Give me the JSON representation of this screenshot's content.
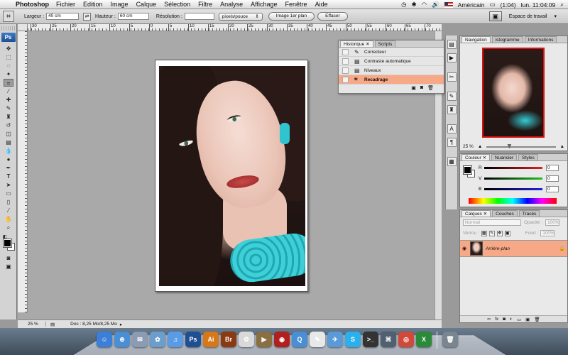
{
  "menubar": {
    "app_name": "Photoshop",
    "menus": [
      "Fichier",
      "Edition",
      "Image",
      "Calque",
      "Sélection",
      "Filtre",
      "Analyse",
      "Affichage",
      "Fenêtre",
      "Aide"
    ],
    "input_source": "Américain",
    "battery": "(1:04)",
    "clock": "lun. 11:04:09"
  },
  "options_bar": {
    "width_label": "Largeur :",
    "width_value": "40 cm",
    "height_label": "Hauteur :",
    "height_value": "60 cm",
    "resolution_label": "Résolution :",
    "resolution_value": "",
    "unit_select": "pixels/pouce",
    "front_image_button": "Image 1er plan",
    "clear_button": "Effacer",
    "workspace_label": "Espace de travail"
  },
  "rulers": {
    "top_ticks": [
      "30",
      "25",
      "20",
      "15",
      "10",
      "5",
      "0",
      "5",
      "10",
      "15",
      "20",
      "25",
      "30",
      "35",
      "40",
      "45",
      "50",
      "55",
      "60",
      "65",
      "70"
    ]
  },
  "status_bar": {
    "zoom": "25 %",
    "doc_size": "Doc : 8,25 Mo/8,25 Mo"
  },
  "history_panel": {
    "tabs": [
      "Historique",
      "Scripts"
    ],
    "items": [
      {
        "label": "Correcteur",
        "icon": "brush-icon",
        "active": false
      },
      {
        "label": "Contraste automatique",
        "icon": "document-icon",
        "active": false
      },
      {
        "label": "Niveaux",
        "icon": "document-icon",
        "active": false
      },
      {
        "label": "Recadrage",
        "icon": "crop-icon",
        "active": true
      }
    ]
  },
  "navigator_panel": {
    "tabs": [
      "Navigation",
      "istogramme",
      "Informations"
    ],
    "zoom": "25 %"
  },
  "color_panel": {
    "tabs": [
      "Couleur",
      "Nuancier",
      "Styles"
    ],
    "channels": [
      {
        "label": "R",
        "value": "0",
        "color": "#e02020"
      },
      {
        "label": "V",
        "value": "0",
        "color": "#20c020"
      },
      {
        "label": "B",
        "value": "0",
        "color": "#2020e0"
      }
    ]
  },
  "layers_panel": {
    "tabs": [
      "Calques",
      "Couches",
      "Tracés"
    ],
    "blend_mode": "Normal",
    "opacity_label": "Opacité :",
    "opacity_value": "100%",
    "lock_label": "Verrou :",
    "fill_label": "Fond :",
    "fill_value": "100%",
    "layer_name": "Arrière-plan"
  },
  "tools_panel": {
    "badge": "Ps"
  },
  "dock": {
    "apps": [
      {
        "name": "Finder",
        "color": "#3b7fd9",
        "glyph": "☺"
      },
      {
        "name": "Safari",
        "color": "#4a8fd6",
        "glyph": "⊕"
      },
      {
        "name": "Mail",
        "color": "#8a9bb3",
        "glyph": "✉"
      },
      {
        "name": "iPhoto",
        "color": "#6b9ecc",
        "glyph": "✿"
      },
      {
        "name": "iTunes",
        "color": "#5a9be8",
        "glyph": "♫"
      },
      {
        "name": "Photoshop",
        "color": "#1f4f93",
        "glyph": "Ps"
      },
      {
        "name": "Illustrator",
        "color": "#d67718",
        "glyph": "Ai"
      },
      {
        "name": "Bridge",
        "color": "#8a3a12",
        "glyph": "Br"
      },
      {
        "name": "Utility",
        "color": "#d9d9d9",
        "glyph": "⚙"
      },
      {
        "name": "DVD",
        "color": "#8a7040",
        "glyph": "▶"
      },
      {
        "name": "Photo Booth",
        "color": "#b02020",
        "glyph": "◉"
      },
      {
        "name": "QuickTime",
        "color": "#4a8fd6",
        "glyph": "Q"
      },
      {
        "name": "PDF",
        "color": "#e8e8e8",
        "glyph": "✎"
      },
      {
        "name": "Stamp",
        "color": "#5a9ad8",
        "glyph": "✈"
      },
      {
        "name": "Skype",
        "color": "#2ab0ec",
        "glyph": "S"
      },
      {
        "name": "Terminal",
        "color": "#333333",
        "glyph": ">_"
      },
      {
        "name": "Network",
        "color": "#506070",
        "glyph": "⌘"
      },
      {
        "name": "Chrome",
        "color": "#d04a3a",
        "glyph": "◎"
      },
      {
        "name": "Excel",
        "color": "#2a8a3a",
        "glyph": "X"
      },
      {
        "name": "Trash",
        "color": "#7a8590",
        "glyph": "🗑"
      }
    ]
  }
}
